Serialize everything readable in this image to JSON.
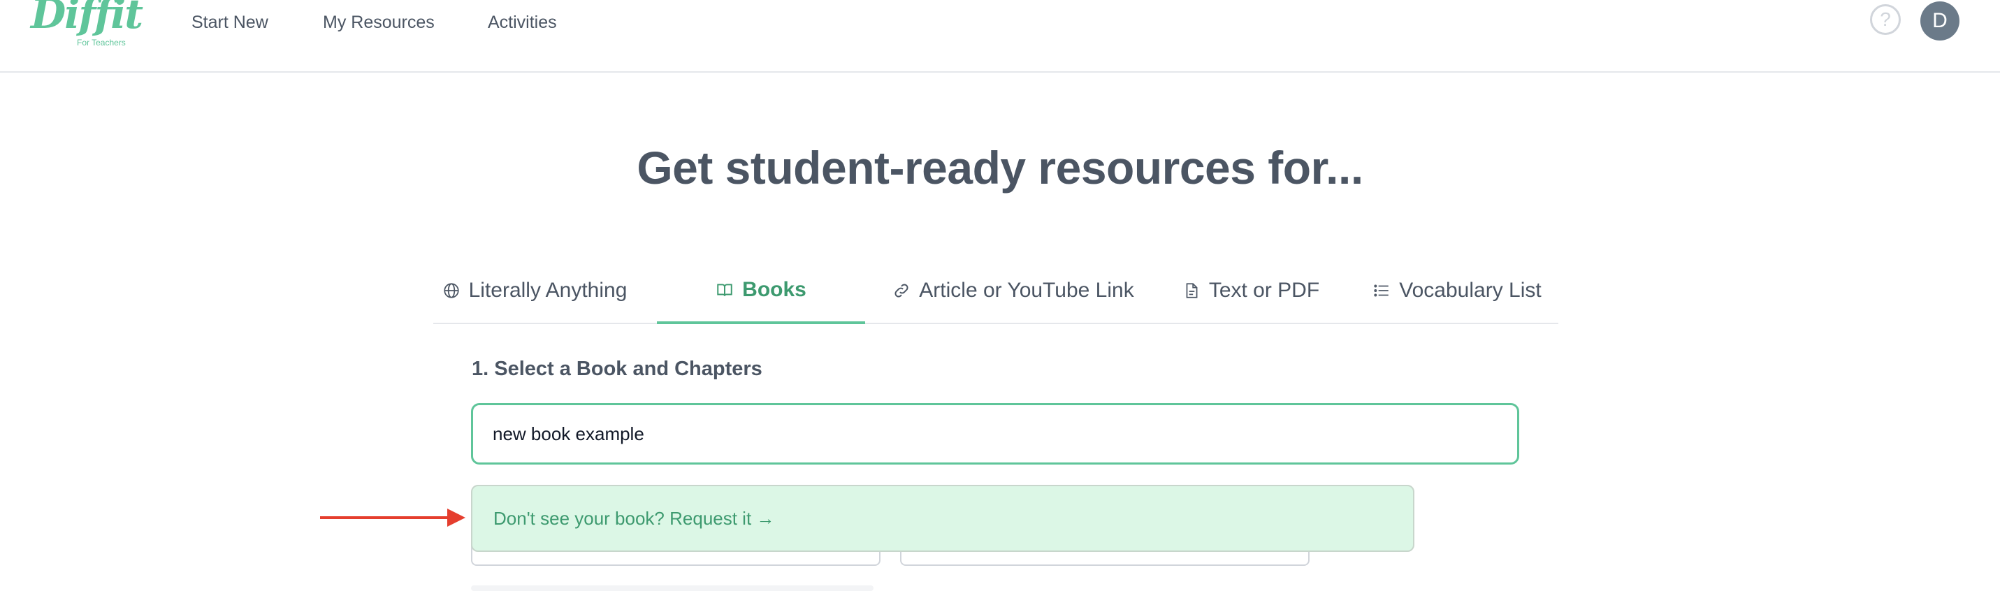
{
  "header": {
    "logo_text": "Diffit",
    "logo_subtext": "For Teachers",
    "nav": [
      "Start New",
      "My Resources",
      "Activities"
    ],
    "help_icon_glyph": "?",
    "avatar_initial": "D"
  },
  "main": {
    "title": "Get student-ready resources for...",
    "tabs": [
      {
        "label": "Literally Anything",
        "icon": "globe-icon",
        "active": false
      },
      {
        "label": "Books",
        "icon": "book-icon",
        "active": true
      },
      {
        "label": "Article or YouTube Link",
        "icon": "link-icon",
        "active": false
      },
      {
        "label": "Text or PDF",
        "icon": "document-icon",
        "active": false
      },
      {
        "label": "Vocabulary List",
        "icon": "list-icon",
        "active": false
      }
    ],
    "section_title": "1. Select a Book and Chapters",
    "book_input_value": "new book example",
    "suggestion_text": "Don't see your book? Request it →"
  },
  "colors": {
    "accent": "#5fc59a",
    "accent_text": "#3d9a6f",
    "suggestion_bg": "#dcf7e6",
    "annotation_arrow": "#e53e2e",
    "text": "#4b5563"
  }
}
